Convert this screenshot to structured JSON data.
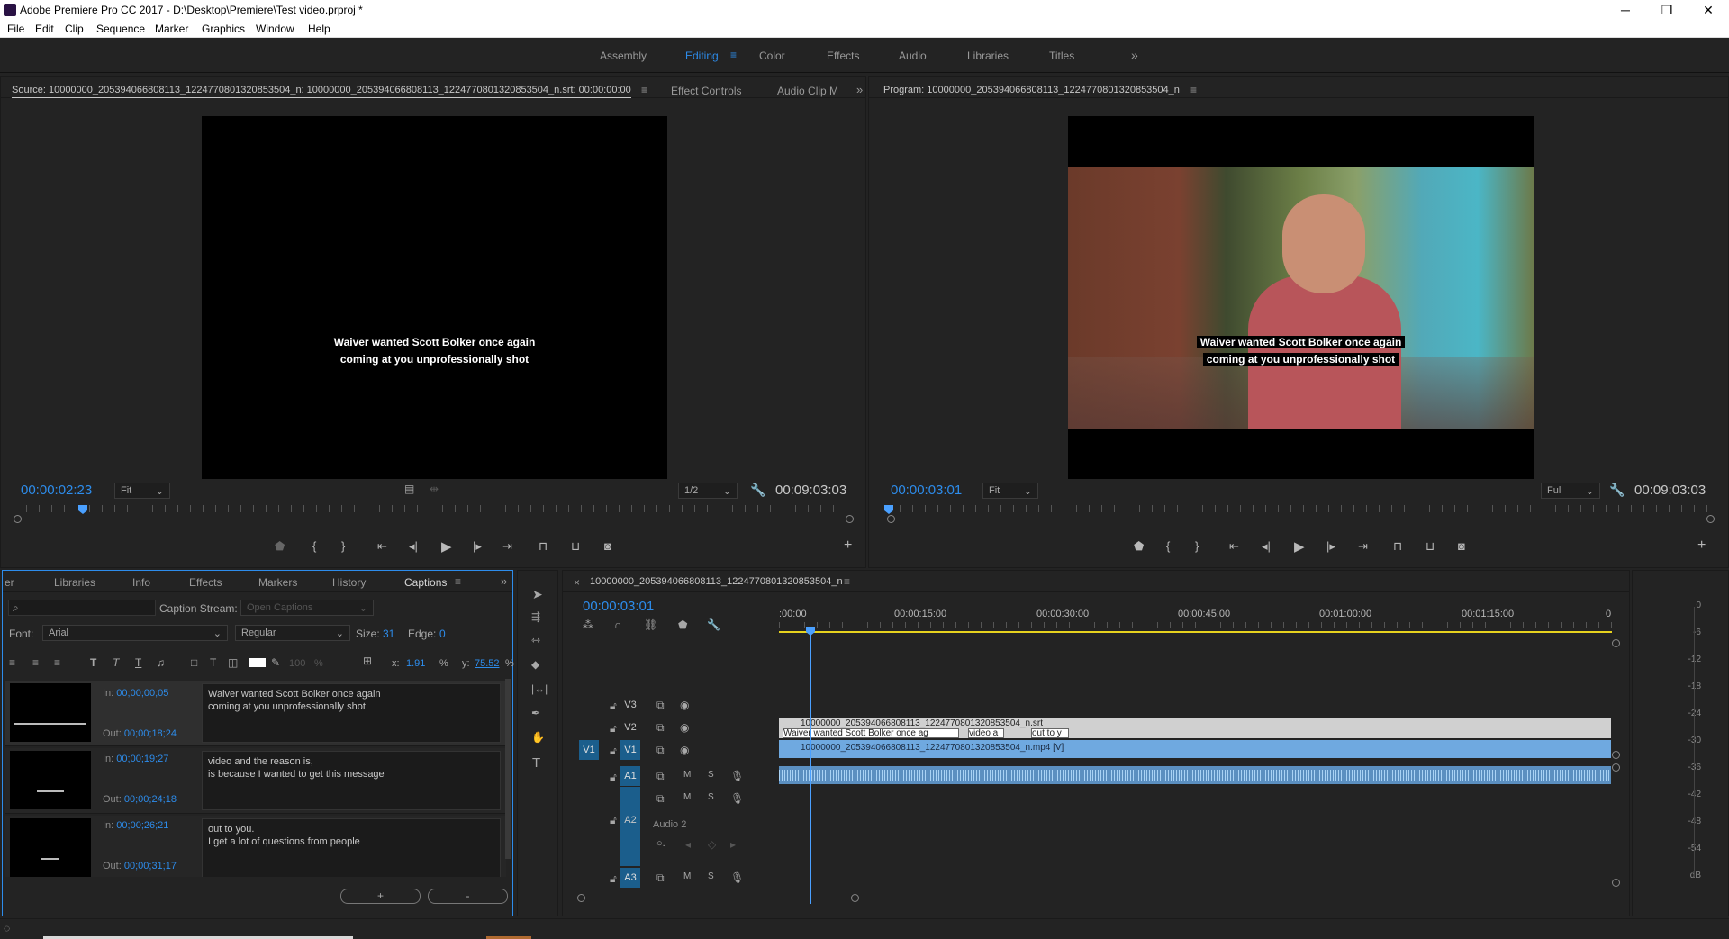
{
  "window": {
    "title": "Adobe Premiere Pro CC 2017 - D:\\Desktop\\Premiere\\Test video.prproj *",
    "min": "─",
    "max": "❐",
    "close": "✕"
  },
  "menu": [
    "File",
    "Edit",
    "Clip",
    "Sequence",
    "Marker",
    "Graphics",
    "Window",
    "Help"
  ],
  "workspaces": [
    "Assembly",
    "Editing",
    "Color",
    "Effects",
    "Audio",
    "Libraries",
    "Titles"
  ],
  "workspace_active": "Editing",
  "source": {
    "tab": "Source: 10000000_205394066808113_1224770801320853504_n: 10000000_205394066808113_1224770801320853504_n.srt: 00:00:00:00",
    "tabs2": [
      "Effect Controls",
      "Audio Clip M"
    ],
    "timecode": "00:00:02:23",
    "fit": "Fit",
    "resolution": "1/2",
    "duration": "00:09:03:03",
    "caption_line1": "Waiver wanted Scott Bolker once again",
    "caption_line2": "coming at you unprofessionally shot"
  },
  "program": {
    "tab": "Program: 10000000_205394066808113_1224770801320853504_n",
    "timecode": "00:00:03:01",
    "fit": "Fit",
    "resolution": "Full",
    "duration": "00:09:03:03",
    "caption_line1": "Waiver wanted Scott Bolker once again",
    "caption_line2": "coming at you unprofessionally shot"
  },
  "bottom_tabs": [
    "er",
    "Libraries",
    "Info",
    "Effects",
    "Markers",
    "History",
    "Captions"
  ],
  "captions": {
    "stream_label": "Caption Stream:",
    "stream_value": "Open Captions",
    "font_label": "Font:",
    "font_value": "Arial",
    "style_value": "Regular",
    "size_label": "Size:",
    "size_value": "31",
    "edge_label": "Edge:",
    "edge_value": "0",
    "x_label": "x:",
    "x_value": "1.91",
    "pct": "%",
    "y_label": "y:",
    "y_value": "75.52",
    "opacity": "100",
    "in_label": "In:",
    "out_label": "Out:",
    "add": "+",
    "remove": "-",
    "items": [
      {
        "in": "00;00;00;05",
        "out": "00;00;18;24",
        "text": "Waiver wanted Scott Bolker once again\ncoming at you unprofessionally shot"
      },
      {
        "in": "00;00;19;27",
        "out": "00;00;24;18",
        "text": "video and the reason is,\nis because I wanted to get this message"
      },
      {
        "in": "00;00;26;21",
        "out": "00;00;31;17",
        "text": "out to you.\nI get a lot of questions from people"
      }
    ]
  },
  "timeline": {
    "tab": "10000000_205394066808113_1224770801320853504_n",
    "timecode": "00:00:03:01",
    "ruler": [
      ":00:00",
      "00:00:15:00",
      "00:00:30:00",
      "00:00:45:00",
      "00:01:00:00",
      "00:01:15:00",
      "0"
    ],
    "tracks": [
      "V3",
      "V2",
      "V1",
      "A1",
      "A2",
      "A3"
    ],
    "v1_patch": "V1",
    "audio2_name": "Audio 2",
    "srt_clip": "10000000_205394066808113_1224770801320853504_n.srt",
    "cap_clips": [
      "Waiver wanted Scott Bolker once ag",
      "video a",
      "out to y"
    ],
    "video_clip": "10000000_205394066808113_1224770801320853504_n.mp4 [V]",
    "m": "M",
    "s": "S"
  },
  "meter": [
    "0",
    "-6",
    "-12",
    "-18",
    "-24",
    "-30",
    "-36",
    "-42",
    "-48",
    "-54",
    "dB"
  ],
  "colors": {
    "accent": "#2d8ceb",
    "panel": "#232323",
    "clip_video": "#7ab3e6",
    "clip_audio": "#5b8fc0",
    "playhead": "#4aa0ff"
  }
}
